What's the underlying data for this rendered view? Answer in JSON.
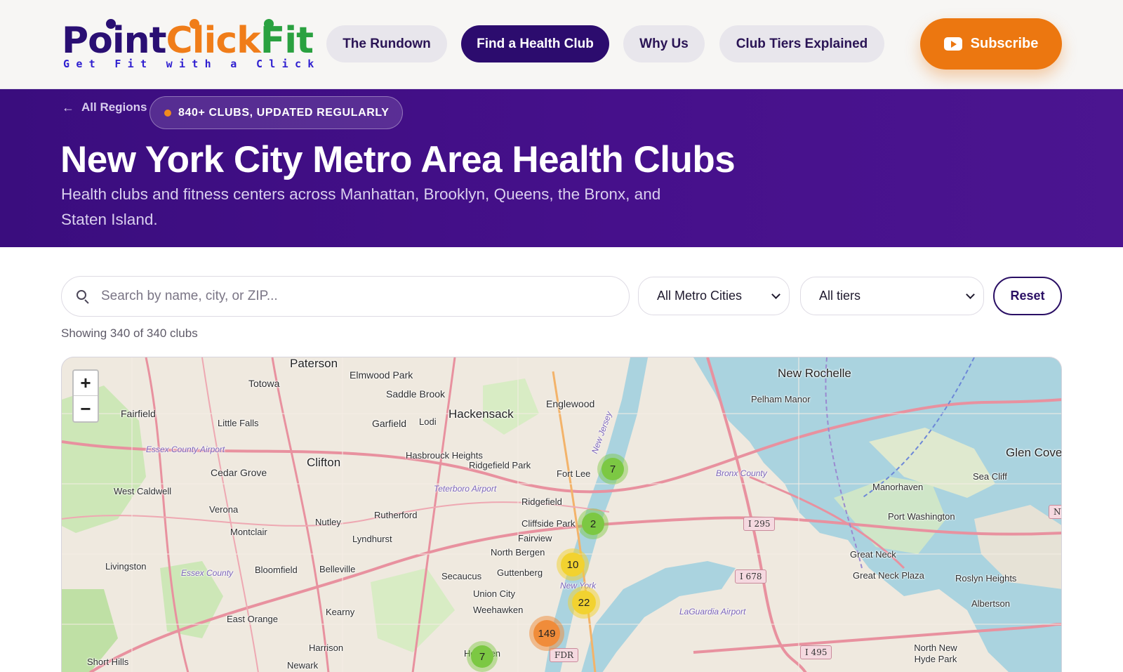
{
  "brand": {
    "name_point": "Point",
    "name_click": "Click",
    "name_fit": "Fit",
    "tagline": "Get Fit with a Click",
    "colors": {
      "primary": "#2c0c6e",
      "accent": "#ec7710",
      "green": "#2aa140"
    }
  },
  "nav": {
    "items": [
      {
        "label": "The Rundown",
        "active": false
      },
      {
        "label": "Find a Health Club",
        "active": true
      },
      {
        "label": "Why Us",
        "active": false
      },
      {
        "label": "Club Tiers Explained",
        "active": false
      }
    ],
    "subscribe_label": "Subscribe",
    "subscribe_icon": "youtube-icon"
  },
  "hero": {
    "back_label": "All Regions",
    "back_icon": "arrow-left-icon",
    "pill_text": "840+ CLUBS, UPDATED REGULARLY",
    "title": "New York City Metro Area Health Clubs",
    "subtitle": "Health clubs and fitness centers across Manhattan, Brooklyn, Queens, the Bronx, and Staten Island."
  },
  "filters": {
    "search_placeholder": "Search by name, city, or ZIP...",
    "search_value": "",
    "city_select": "All Metro Cities",
    "tier_select": "All tiers",
    "reset_label": "Reset",
    "showing_text": "Showing 340 of 340 clubs"
  },
  "map": {
    "zoom_in": "+",
    "zoom_out": "−",
    "places": [
      "Paterson",
      "Totowa",
      "Elmwood Park",
      "Saddle Brook",
      "Hackensack",
      "Englewood",
      "New Rochelle",
      "Pelham Manor",
      "Fairfield",
      "Little Falls",
      "Garfield",
      "Lodi",
      "Glen Cove",
      "Sea Cliff",
      "Essex County Airport",
      "Hasbrouck Heights",
      "Ridgefield Park",
      "Fort Lee",
      "Bronx County",
      "Clifton",
      "Cedar Grove",
      "Teterboro Airport",
      "Manorhaven",
      "West Caldwell",
      "Ridgefield",
      "Verona",
      "Rutherford",
      "Port Washington",
      "Nutley",
      "Cliffside Park",
      "Montclair",
      "Lyndhurst",
      "Fairview",
      "North Bergen",
      "Great Neck",
      "Livingston",
      "Essex County",
      "Bloomfield",
      "Belleville",
      "Secaucus",
      "Guttenberg",
      "Great Neck Plaza",
      "Roslyn Heights",
      "Union City",
      "New York",
      "Weehawken",
      "Albertson",
      "Kearny",
      "LaGuardia Airport",
      "East Orange",
      "Harrison",
      "Hoboken",
      "North New Hyde Park",
      "Short Hills",
      "Newark",
      "New Jersey"
    ],
    "highways": [
      "I 295",
      "I 678",
      "I 495",
      "FDR",
      "NY"
    ],
    "clusters": [
      {
        "count": "7",
        "color": "#7cc843"
      },
      {
        "count": "2",
        "color": "#7cc843"
      },
      {
        "count": "10",
        "color": "#f2d230"
      },
      {
        "count": "22",
        "color": "#f2d230"
      },
      {
        "count": "149",
        "color": "#f08c3a"
      },
      {
        "count": "7",
        "color": "#7cc843"
      }
    ]
  }
}
